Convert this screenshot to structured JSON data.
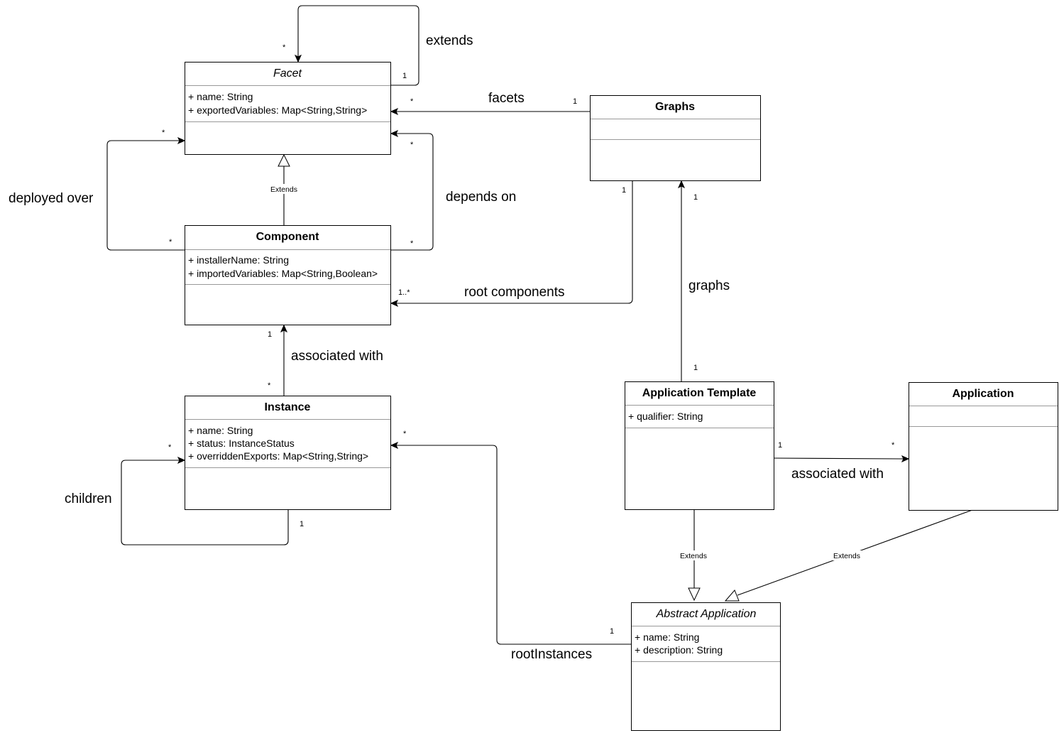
{
  "diagram": {
    "type": "uml-class-diagram",
    "classes": {
      "facet": {
        "name": "Facet",
        "abstract": true,
        "attributes": [
          "+ name: String",
          "+ exportedVariables: Map<String,String>"
        ]
      },
      "component": {
        "name": "Component",
        "abstract": false,
        "attributes": [
          "+ installerName: String",
          "+ importedVariables: Map<String,Boolean>"
        ]
      },
      "instance": {
        "name": "Instance",
        "abstract": false,
        "attributes": [
          "+ name: String",
          "+ status: InstanceStatus",
          "+ overriddenExports: Map<String,String>"
        ]
      },
      "graphs": {
        "name": "Graphs",
        "abstract": false,
        "attributes": []
      },
      "application_template": {
        "name": "Application Template",
        "abstract": false,
        "attributes": [
          "+ qualifier: String"
        ]
      },
      "application": {
        "name": "Application",
        "abstract": false,
        "attributes": []
      },
      "abstract_application": {
        "name": "Abstract Application",
        "abstract": true,
        "attributes": [
          "+ name: String",
          "+ description: String"
        ]
      }
    },
    "relations": {
      "facet_extends": {
        "label": "extends",
        "from": "Facet",
        "to": "Facet",
        "source_mult": "1",
        "target_mult": "*"
      },
      "facets": {
        "label": "facets",
        "from": "Graphs",
        "to": "Facet",
        "source_mult": "1",
        "target_mult": "*"
      },
      "deployed_over": {
        "label": "deployed over",
        "from": "Component",
        "to": "Facet",
        "source_mult": "*",
        "target_mult": "*"
      },
      "depends_on": {
        "label": "depends on",
        "from": "Component",
        "to": "Facet",
        "source_mult": "*",
        "target_mult": "*"
      },
      "component_extends_facet": {
        "label": "Extends",
        "from": "Component",
        "to": "Facet",
        "kind": "generalization"
      },
      "root_components": {
        "label": "root components",
        "from": "Graphs",
        "to": "Component",
        "source_mult": "1",
        "target_mult": "1..*"
      },
      "instance_component": {
        "label": "associated with",
        "from": "Instance",
        "to": "Component",
        "source_mult": "*",
        "target_mult": "1"
      },
      "children": {
        "label": "children",
        "from": "Instance",
        "to": "Instance",
        "source_mult": "1",
        "target_mult": "*"
      },
      "graphs": {
        "label": "graphs",
        "from": "Application Template",
        "to": "Graphs",
        "source_mult": "1",
        "target_mult": "1"
      },
      "template_application": {
        "label": "associated with",
        "from": "Application Template",
        "to": "Application",
        "source_mult": "1",
        "target_mult": "*"
      },
      "template_extends": {
        "label": "Extends",
        "from": "Application Template",
        "to": "Abstract Application",
        "kind": "generalization"
      },
      "application_extends": {
        "label": "Extends",
        "from": "Application",
        "to": "Abstract Application",
        "kind": "generalization"
      },
      "root_instances": {
        "label": "rootInstances",
        "from": "Abstract Application",
        "to": "Instance",
        "source_mult": "1",
        "target_mult": "*"
      }
    }
  }
}
